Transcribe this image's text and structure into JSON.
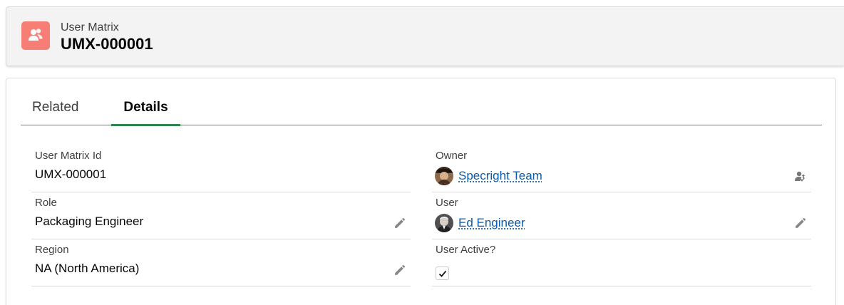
{
  "header": {
    "record_type": "User Matrix",
    "record_name": "UMX-000001",
    "icon": "user-matrix-icon",
    "icon_color": "#f77e75"
  },
  "tabs": [
    {
      "label": "Related",
      "active": false
    },
    {
      "label": "Details",
      "active": true
    }
  ],
  "fields": {
    "user_matrix_id": {
      "label": "User Matrix Id",
      "value": "UMX-000001"
    },
    "owner": {
      "label": "Owner",
      "value": "Specright Team",
      "action_icon": "change-owner-icon"
    },
    "role": {
      "label": "Role",
      "value": "Packaging Engineer",
      "action_icon": "pencil-edit-icon"
    },
    "user": {
      "label": "User",
      "value": "Ed Engineer",
      "action_icon": "pencil-edit-icon"
    },
    "region": {
      "label": "Region",
      "value": "NA (North America)",
      "action_icon": "pencil-edit-icon"
    },
    "user_active": {
      "label": "User Active?",
      "checked": true
    }
  },
  "colors": {
    "link": "#0b5cab",
    "active_tab_underline": "#2e844a"
  }
}
